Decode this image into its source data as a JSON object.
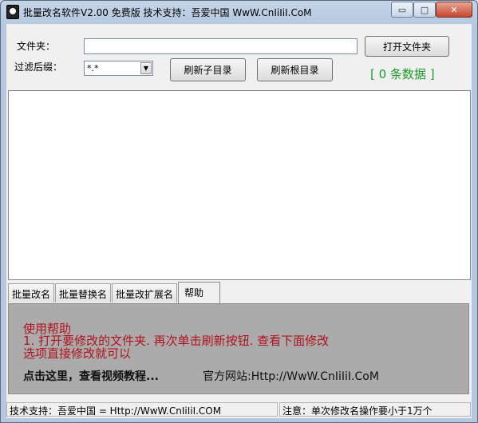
{
  "window": {
    "title": "批量改名软件V2.00  免费版   技术支持：吾爱中国  WwW.CnIiIiI.CoM",
    "minimize_glyph": "▭",
    "maximize_glyph": "□",
    "close_glyph": "✕"
  },
  "top": {
    "folder_label": "文件夹：",
    "folder_value": "",
    "filter_label": "过滤后缀：",
    "filter_value": "*.*",
    "open_folder_button": "打开文件夹",
    "refresh_sub_button": "刷新子目录",
    "refresh_root_button": "刷新根目录",
    "count_text": "[ 0 条数据 ]",
    "count_color": "#1e9a2a"
  },
  "file_list": {
    "rows": []
  },
  "tabs": [
    {
      "label": "批量改名"
    },
    {
      "label": "批量替换名"
    },
    {
      "label": "批量改扩展名"
    },
    {
      "label": "帮助"
    }
  ],
  "help": {
    "title": "使用帮助",
    "line1": "1. 打开要修改的文件夹. 再次单击刷新按钮. 查看下面修改",
    "line2": "选项直接修改就可以",
    "video_link": "点击这里，查看视频教程...",
    "site": "官方网站:Http://WwW.CnIiIiI.CoM",
    "text_color": "#b0121d"
  },
  "status": {
    "left": "技术支持：吾爱中国 = Http://WwW.CnIiIiI.COM",
    "right": "注意：单次修改名操作要小于1万个"
  }
}
